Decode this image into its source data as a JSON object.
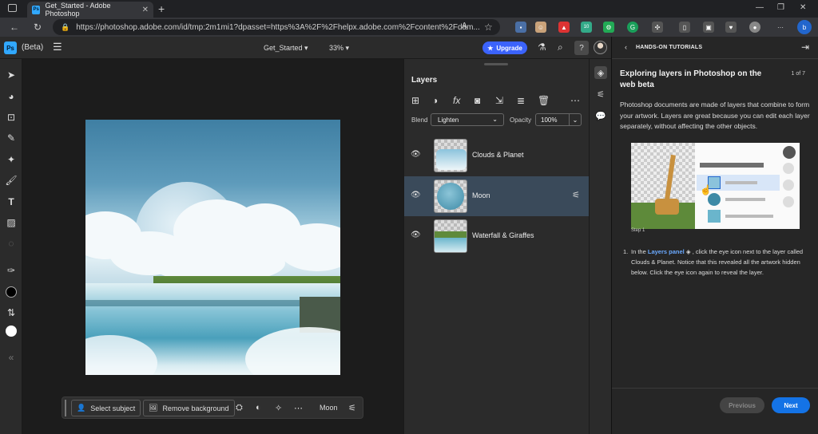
{
  "browser": {
    "tab_title": "Get_Started - Adobe Photoshop",
    "tab_favicon": "Ps",
    "url": "https://photoshop.adobe.com/id/tmp:2m1mi1?dpasset=https%3A%2F%2Fhelpx.adobe.com%2Fcontent%2Fdam...",
    "extension_badge": "10"
  },
  "header": {
    "logo": "Ps",
    "beta": "(Beta)",
    "document_name": "Get_Started",
    "zoom": "33%",
    "upgrade_label": "Upgrade"
  },
  "context_bar": {
    "select_subject": "Select subject",
    "remove_background": "Remove background",
    "layer_name": "Moon"
  },
  "layers_panel": {
    "title": "Layers",
    "blend_label": "Blend",
    "blend_value": "Lighten",
    "opacity_label": "Opacity",
    "opacity_value": "100%",
    "layers": [
      {
        "name": "Clouds & Planet",
        "selected": false
      },
      {
        "name": "Moon",
        "selected": true
      },
      {
        "name": "Waterfall & Giraffes",
        "selected": false
      }
    ]
  },
  "tutorial": {
    "header": "HANDS-ON TUTORIALS",
    "title": "Exploring layers in Photoshop on the web beta",
    "counter": "1 of 7",
    "body": "Photoshop documents are made of layers that combine to form your artwork. Layers are great because you can edit each layer separately, without affecting the other objects.",
    "step_label": "Step 1",
    "step_number": "1.",
    "step_text_pre": "In the",
    "step_link": "Layers panel",
    "step_text_post": ", click the eye icon next to the layer called Clouds & Planet. Notice that this revealed all the artwork hidden below. Click the eye icon again to reveal the layer.",
    "prev_label": "Previous",
    "next_label": "Next"
  },
  "colors": {
    "accent": "#1473e6",
    "upgrade": "#3b63fb",
    "selected_layer": "#3a4a5a"
  }
}
